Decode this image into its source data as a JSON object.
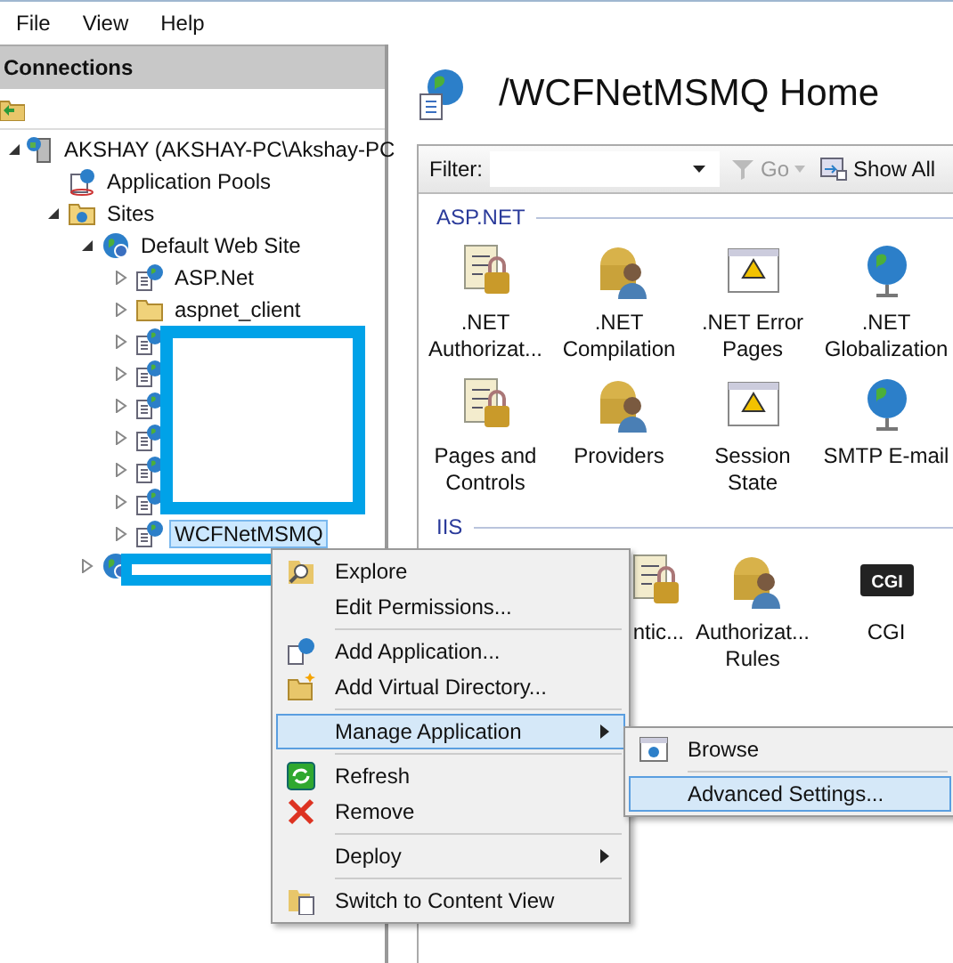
{
  "menu_bar": [
    {
      "label": "File"
    },
    {
      "label": "View"
    },
    {
      "label": "Help"
    }
  ],
  "connections": {
    "title": "Connections",
    "tree": [
      {
        "label": "AKSHAY (AKSHAY-PC\\Akshay-PC",
        "kind": "server",
        "expanded": true,
        "selected": false,
        "children": [
          {
            "label": "Application Pools",
            "kind": "pool",
            "selected": false
          },
          {
            "label": "Sites",
            "kind": "sites",
            "expanded": true,
            "selected": false,
            "children": [
              {
                "label": "Default Web Site",
                "kind": "site",
                "expanded": true,
                "selected": false,
                "children": [
                  {
                    "label": "ASP.Net",
                    "kind": "app",
                    "expanded": false,
                    "selected": false
                  },
                  {
                    "label": "aspnet_client",
                    "kind": "folder",
                    "expanded": false,
                    "selected": false
                  },
                  {
                    "kind": "app",
                    "expanded": false
                  },
                  {
                    "kind": "app",
                    "expanded": false
                  },
                  {
                    "kind": "app",
                    "expanded": false
                  },
                  {
                    "kind": "app",
                    "expanded": false
                  },
                  {
                    "kind": "app",
                    "expanded": false
                  },
                  {
                    "kind": "app",
                    "expanded": false
                  },
                  {
                    "label": "WCFNetMSMQ",
                    "kind": "app",
                    "expanded": false,
                    "selected": true
                  }
                ]
              },
              {
                "kind": "site",
                "expanded": false
              }
            ]
          }
        ]
      }
    ]
  },
  "feature_page": {
    "title": "/WCFNetMSMQ Home",
    "filter_label": "Filter:",
    "go_button": {
      "label": "Go",
      "disabled": true
    },
    "show_all_button": "Show All",
    "groups": [
      {
        "name": "ASP.NET",
        "features": [
          {
            "label": ".NET Authorizat..."
          },
          {
            "label": ".NET Compilation"
          },
          {
            "label": ".NET Error Pages"
          },
          {
            "label": ".NET Globalization"
          },
          {
            "label": "Pages and Controls"
          },
          {
            "label": "Providers"
          },
          {
            "label": "Session State"
          },
          {
            "label": "SMTP E-mail"
          }
        ]
      },
      {
        "name": "IIS",
        "features": [
          {
            "label": "ntic..."
          },
          {
            "label": "Authorizat... Rules"
          },
          {
            "label": "CGI",
            "icon_text": "CGI"
          }
        ]
      }
    ]
  },
  "context_menu": {
    "sections": [
      [
        {
          "label": "Explore",
          "selected": false
        },
        {
          "label": "Edit Permissions...",
          "selected": false
        }
      ],
      [
        {
          "label": "Add Application...",
          "selected": false
        },
        {
          "label": "Add Virtual Directory...",
          "selected": false
        }
      ],
      [
        {
          "label": "Manage Application",
          "selected": true,
          "submenu": true
        }
      ],
      [
        {
          "label": "Refresh",
          "selected": false
        },
        {
          "label": "Remove",
          "selected": false
        }
      ],
      [
        {
          "label": "Deploy",
          "selected": false,
          "submenu": true
        }
      ],
      [
        {
          "label": "Switch to Content View",
          "selected": false
        }
      ]
    ],
    "submenu": [
      {
        "label": "Browse",
        "selected": false
      },
      {
        "label": "Advanced Settings...",
        "selected": true
      }
    ]
  }
}
